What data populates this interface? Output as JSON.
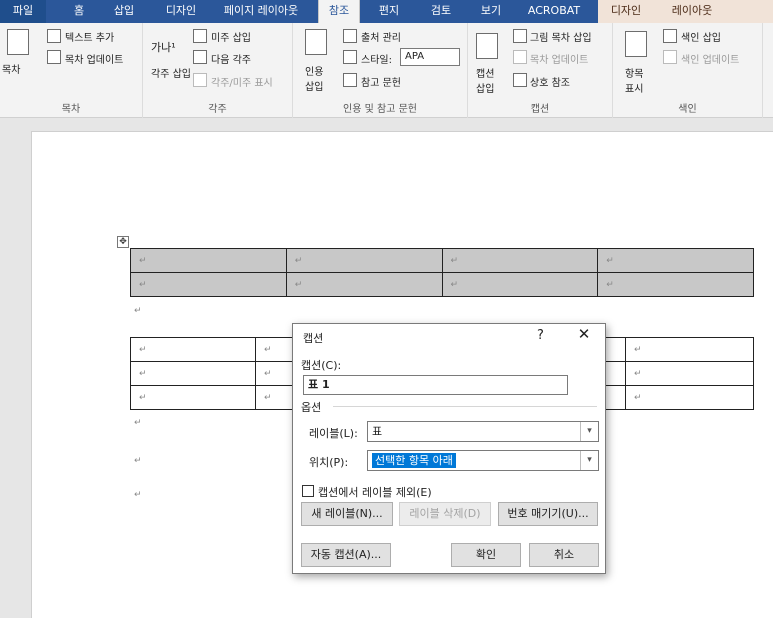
{
  "tabs": [
    "파일",
    "홈",
    "삽입",
    "디자인",
    "페이지 레이아웃",
    "참조",
    "편지",
    "검토",
    "보기",
    "ACROBAT",
    "디자인",
    "레이아웃"
  ],
  "ribbon": {
    "toc": {
      "big": "목차",
      "add_text": "텍스트 추가",
      "update": "목차 업데이트",
      "group": "목차"
    },
    "footnotes": {
      "insert_footnote": "각주 삽입",
      "insert_endnote": "미주 삽입",
      "next": "다음 각주",
      "show": "각주/미주 표시",
      "group": "각주"
    },
    "citations": {
      "insert": "인용 삽입",
      "manage": "출처 관리",
      "style_label": "스타일:",
      "style_value": "APA",
      "bib": "참고 문헌",
      "group": "인용 및 참고 문헌"
    },
    "captions": {
      "insert": "캡션 삽입",
      "fig_toc": "그림 목차 삽입",
      "update": "목차 업데이트",
      "cross": "상호 참조",
      "group": "캡션"
    },
    "index": {
      "mark": "항목 표시",
      "insert": "색인 삽입",
      "update": "색인 업데이트",
      "group": "색인"
    }
  },
  "dialog": {
    "title": "캡션",
    "help": "?",
    "close": "✕",
    "caption_label": "캡션(C):",
    "caption_value": "표 1",
    "options_label": "옵션",
    "label_label": "레이블(L):",
    "label_value": "표",
    "position_label": "위치(P):",
    "position_value": "선택한 항목 아래",
    "exclude_label": "캡션에서 레이블 제외(E)",
    "new_label_btn": "새 레이블(N)...",
    "delete_label_btn": "레이블 삭제(D)",
    "numbering_btn": "번호 매기기(U)...",
    "autocaption_btn": "자동 캡션(A)...",
    "ok_btn": "확인",
    "cancel_btn": "취소"
  },
  "doc": {
    "para_mark": "↵",
    "anchor": "✥"
  }
}
